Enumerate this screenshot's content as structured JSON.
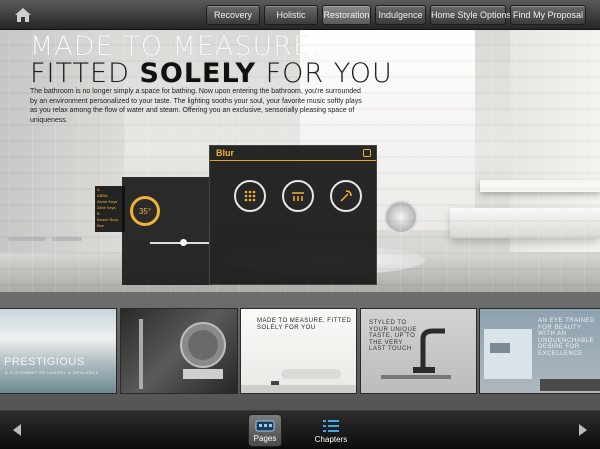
{
  "topbar": {
    "nav": [
      {
        "label": "Recovery",
        "active": false
      },
      {
        "label": "Holistic",
        "active": false
      },
      {
        "label": "Restoration",
        "active": true
      },
      {
        "label": "Indulgence",
        "active": false
      },
      {
        "label": "Home Style Options",
        "active": false
      },
      {
        "label": "Find My Proposal",
        "active": false
      }
    ]
  },
  "hero": {
    "headline_line1": "MADE TO MEASURE,",
    "headline_line2_a": "FITTED ",
    "headline_line2_b": "SOLELY",
    "headline_line2_c": " FOR YOU",
    "body": "The bathroom is no longer simply a space for bathing.  Now upon entering the bathroom, you're surrounded by an environment personalized to your taste. The lighting sooths your soul, your favorite music softly plays as you relax among the flow of water and steam. Offering you an exclusive, sensorially pleasing space of uniqueness.",
    "panel": {
      "title": "Blur",
      "dial_value": "35°",
      "playlist": [
        "A",
        "ABBA",
        "Alone Keys",
        "Alice Keys",
        "B",
        "Beach Boys",
        "Bee"
      ]
    }
  },
  "thumbnails": [
    {
      "text": "PRESTIGIOUS",
      "sub": "A STATEMENT OF LUXURY & OPULENCE"
    },
    {
      "text": ""
    },
    {
      "text": "MADE TO MEASURE, FITTED SOLELY FOR YOU"
    },
    {
      "text": "STYLED TO YOUR UNIQUE TASTE, UP TO THE VERY LAST TOUCH"
    },
    {
      "text": "AN EYE TRAINED FOR BEAUTY WITH AN UNQUENCHABLE DESIRE FOR EXCELLENCE"
    }
  ],
  "bottombar": {
    "pages_label": "Pages",
    "chapters_label": "Chapters"
  },
  "colors": {
    "accent": "#f1b136",
    "chapters_icon": "#3ea8e8"
  },
  "icons": [
    "home-icon",
    "arrow-left-icon",
    "arrow-right-icon",
    "pages-icon",
    "chapters-icon",
    "lock-icon"
  ]
}
